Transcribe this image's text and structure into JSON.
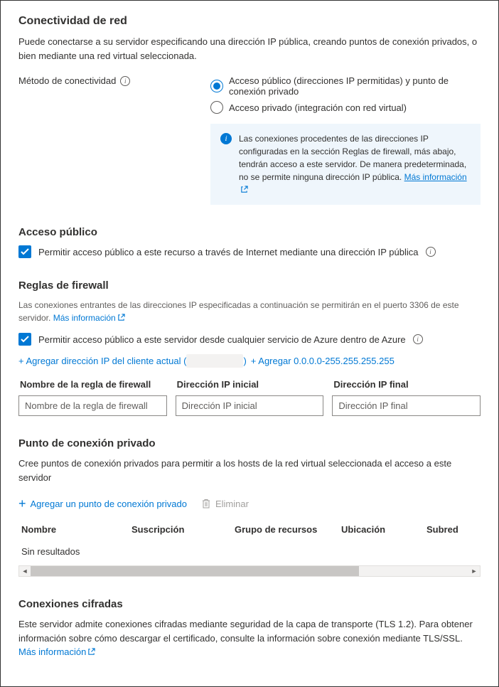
{
  "header": {
    "title": "Conectividad de red",
    "description": "Puede conectarse a su servidor especificando una dirección IP pública, creando puntos de conexión privados, o bien mediante una red virtual seleccionada."
  },
  "connectivity": {
    "label": "Método de conectividad",
    "options": [
      "Acceso público (direcciones IP permitidas) y punto de conexión privado",
      "Acceso privado (integración con red virtual)"
    ],
    "selected": 0,
    "banner": "Las conexiones procedentes de las direcciones IP configuradas en la sección Reglas de firewall, más abajo, tendrán acceso a este servidor. De manera predeterminada, no se permite ninguna dirección IP pública.",
    "banner_link": "Más información"
  },
  "public_access": {
    "title": "Acceso público",
    "checkbox": "Permitir acceso público a este recurso a través de Internet mediante una dirección IP pública"
  },
  "firewall": {
    "title": "Reglas de firewall",
    "description": "Las conexiones entrantes de las direcciones IP especificadas a continuación se permitirán en el puerto 3306 de este servidor.",
    "desc_link": "Más información",
    "checkbox": "Permitir acceso público a este servidor desde cualquier servicio de Azure dentro de Azure",
    "add_client_prefix": "+ Agregar dirección IP del cliente actual (",
    "add_client_suffix": ")",
    "add_range": "+ Agregar 0.0.0.0-255.255.255.255",
    "columns": {
      "name": "Nombre de la regla de firewall",
      "start": "Dirección IP inicial",
      "end": "Dirección IP final"
    },
    "placeholders": {
      "name": "Nombre de la regla de firewall",
      "start": "Dirección IP inicial",
      "end": "Dirección IP final"
    }
  },
  "private_endpoint": {
    "title": "Punto de conexión privado",
    "description": "Cree puntos de conexión privados para permitir a los hosts de la red virtual seleccionada el acceso a este servidor",
    "add_btn": "Agregar un punto de conexión privado",
    "delete_btn": "Eliminar",
    "columns": {
      "name": "Nombre",
      "subscription": "Suscripción",
      "rg": "Grupo de recursos",
      "location": "Ubicación",
      "subnet": "Subred"
    },
    "empty": "Sin resultados"
  },
  "encrypted": {
    "title": "Conexiones cifradas",
    "description": "Este servidor admite conexiones cifradas mediante seguridad de la capa de transporte (TLS 1.2). Para obtener información sobre cómo descargar el certificado, consulte la información sobre conexión mediante TLS/SSL.",
    "link": "Más información"
  }
}
